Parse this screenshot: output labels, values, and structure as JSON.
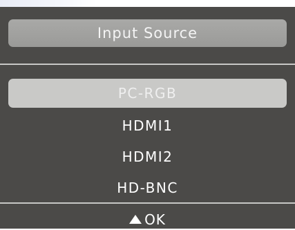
{
  "menu": {
    "title": "Input Source",
    "items": [
      {
        "label": "PC-RGB",
        "selected": true
      },
      {
        "label": "HDMI1",
        "selected": false
      },
      {
        "label": "HDMI2",
        "selected": false
      },
      {
        "label": "HD-BNC",
        "selected": false
      }
    ]
  },
  "footer": {
    "icon": "up-triangle-icon",
    "label": "OK"
  },
  "colors": {
    "panel": "#4b4a48",
    "title_bar": "#a0a09e",
    "selected_item": "#c9c9c7",
    "text": "#ffffff"
  }
}
